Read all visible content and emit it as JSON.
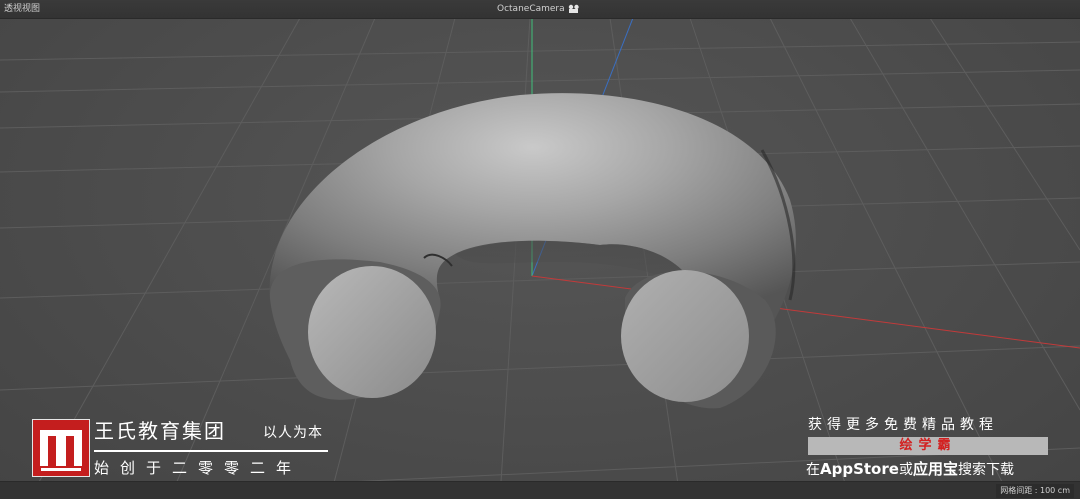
{
  "viewport": {
    "title": "透视视图",
    "camera": "OctaneCamera",
    "camera_icon": "octane-camera-icon",
    "grid_spacing": "网格间距 : 100 cm",
    "axis_colors": {
      "x": "#c23a3a",
      "y": "#3fbf7a",
      "z": "#3a6fc2"
    },
    "object": "torus-half"
  },
  "brand": {
    "logo_icon": "w-logo-icon",
    "name": "王氏教育集团",
    "slogan": "以人为本",
    "founded": "始创于二零零二年",
    "color": "#c41e1e"
  },
  "promo": {
    "line1": "获得更多免费精品教程",
    "app_name": "绘学霸",
    "line3_prefix": "在",
    "appstore": "AppStore",
    "line3_or": "或",
    "store2": "应用宝",
    "line3_suffix": "搜索下载"
  }
}
